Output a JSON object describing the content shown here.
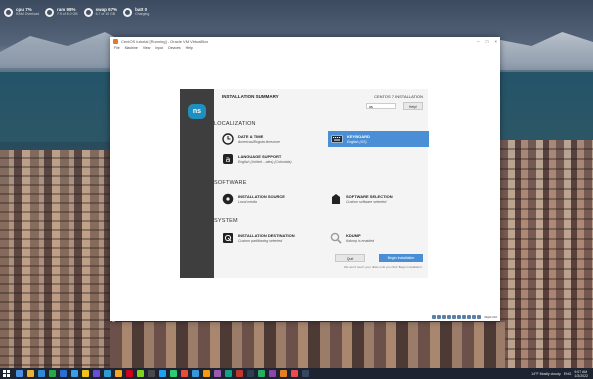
{
  "desktop_gauges": [
    {
      "main": "cpu 7%",
      "sub": "RAM Overload"
    },
    {
      "main": "ram 98%",
      "sub": "7.9 of 8.0 GB"
    },
    {
      "main": "swap 67%",
      "sub": "6.7 of 10 GB"
    },
    {
      "main": "batt 0",
      "sub": "Charging"
    }
  ],
  "window": {
    "title": "CentOS tutorial [Running] - Oracle VM VirtualBox",
    "menu": [
      "File",
      "Machine",
      "View",
      "Input",
      "Devices",
      "Help"
    ],
    "controls": [
      "–",
      "□",
      "×"
    ]
  },
  "installer": {
    "logo": "ns",
    "summary_title": "INSTALLATION SUMMARY",
    "product_title": "CENTOS 7 INSTALLATION",
    "keyboard_flag": "us",
    "help_label": "Help!",
    "sections": {
      "localization": "LOCALIZATION",
      "software": "SOFTWARE",
      "system": "SYSTEM"
    },
    "spokes": {
      "date_time": {
        "name": "DATE & TIME",
        "status": "Americas/Bogota timezone",
        "icon": "clock-icon"
      },
      "keyboard": {
        "name": "KEYBOARD",
        "status": "English (US)",
        "icon": "keyboard-icon"
      },
      "language": {
        "name": "LANGUAGE SUPPORT",
        "status": "English (United ...ates) (Colombia)",
        "icon": "language-icon"
      },
      "install_source": {
        "name": "INSTALLATION SOURCE",
        "status": "Local media",
        "icon": "disc-icon"
      },
      "software_selection": {
        "name": "SOFTWARE SELECTION",
        "status": "Custom software selected",
        "icon": "package-icon"
      },
      "install_dest": {
        "name": "INSTALLATION DESTINATION",
        "status": "Custom partitioning selected",
        "icon": "harddisk-icon"
      },
      "kdump": {
        "name": "KDUMP",
        "status": "Kdump is enabled",
        "icon": "search-icon"
      }
    },
    "quit_label": "Quit",
    "begin_label": "Begin Installation",
    "footnote": "We won't touch your disks until you click 'Begin Installation'.",
    "statusbar_text": "Right Ctrl"
  },
  "taskbar": {
    "tray_text": "14°F  Mostly cloudy",
    "lang": "ENG",
    "time": "9:07 AM",
    "date": "1/3/2022",
    "app_colors": [
      "#4a90e2",
      "#e8b23a",
      "#2f8ad6",
      "#27a844",
      "#2b6fd1",
      "#3aa0e6",
      "#f0c419",
      "#6b4fd1",
      "#2e9bd6",
      "#f5a623",
      "#d0021b",
      "#7ed321",
      "#4a4a4a",
      "#1da1f2",
      "#2ecc71",
      "#e74c3c",
      "#3498db",
      "#f39c12",
      "#9b59b6",
      "#16a085",
      "#c0392b",
      "#2c3e50",
      "#27ae60",
      "#8e44ad",
      "#e67e22",
      "#e84c4c",
      "#34495e"
    ]
  }
}
